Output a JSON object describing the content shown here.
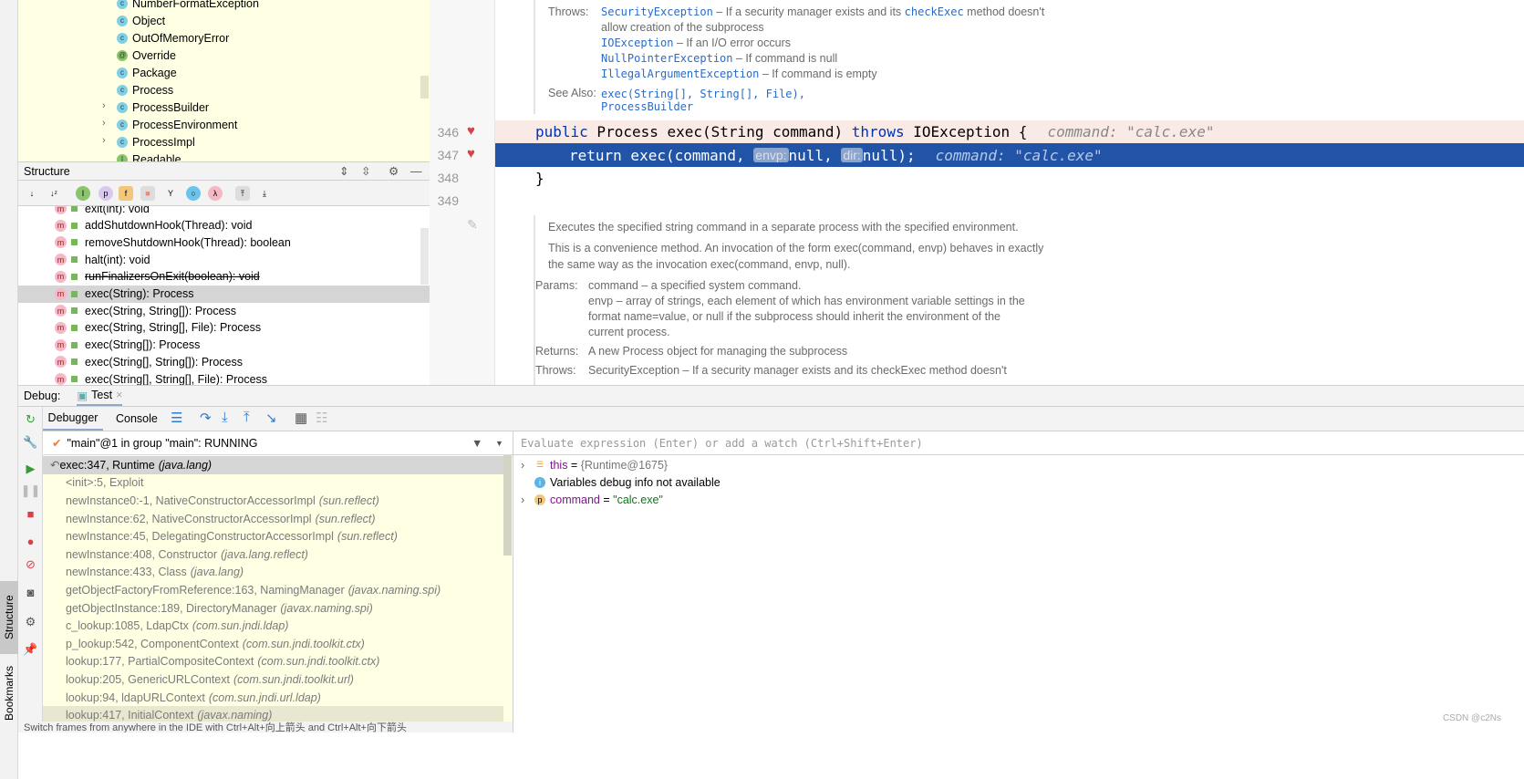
{
  "project_tree": {
    "items": [
      {
        "label": "NumberFormatException",
        "kind": "class",
        "expandable": false
      },
      {
        "label": "Object",
        "kind": "class",
        "expandable": false
      },
      {
        "label": "OutOfMemoryError",
        "kind": "class",
        "expandable": false
      },
      {
        "label": "Override",
        "kind": "annotation",
        "expandable": false
      },
      {
        "label": "Package",
        "kind": "class",
        "expandable": false
      },
      {
        "label": "Process",
        "kind": "abstract-class",
        "expandable": false
      },
      {
        "label": "ProcessBuilder",
        "kind": "class",
        "expandable": true
      },
      {
        "label": "ProcessEnvironment",
        "kind": "class",
        "expandable": true
      },
      {
        "label": "ProcessImpl",
        "kind": "class",
        "expandable": true
      },
      {
        "label": "Readable",
        "kind": "interface",
        "expandable": false
      }
    ]
  },
  "structure": {
    "title": "Structure",
    "items": [
      {
        "label": "exit(int): void",
        "deprecated": false,
        "selected": false
      },
      {
        "label": "addShutdownHook(Thread): void",
        "deprecated": false,
        "selected": false
      },
      {
        "label": "removeShutdownHook(Thread): boolean",
        "deprecated": false,
        "selected": false
      },
      {
        "label": "halt(int): void",
        "deprecated": false,
        "selected": false
      },
      {
        "label": "runFinalizersOnExit(boolean): void",
        "deprecated": true,
        "selected": false
      },
      {
        "label": "exec(String): Process",
        "deprecated": false,
        "selected": true
      },
      {
        "label": "exec(String, String[]): Process",
        "deprecated": false,
        "selected": false
      },
      {
        "label": "exec(String, String[], File): Process",
        "deprecated": false,
        "selected": false
      },
      {
        "label": "exec(String[]): Process",
        "deprecated": false,
        "selected": false
      },
      {
        "label": "exec(String[], String[]): Process",
        "deprecated": false,
        "selected": false
      },
      {
        "label": "exec(String[], String[], File): Process",
        "deprecated": false,
        "selected": false
      }
    ]
  },
  "editor": {
    "doc_top": {
      "throws_label": "Throws:",
      "throws": [
        {
          "name": "SecurityException",
          "text": " – If a security manager exists and its ",
          "code": "checkExec",
          "text2": " method doesn't"
        },
        {
          "name": "",
          "text": "allow creation of the subprocess"
        },
        {
          "name": "IOException",
          "text": " – If an I/O error occurs"
        },
        {
          "name": "NullPointerException",
          "text": " – If command is null"
        },
        {
          "name": "IllegalArgumentException",
          "text": " – If command is empty"
        }
      ],
      "see_also_label": "See Also:",
      "see_also": [
        "exec(String[], String[], File),",
        "ProcessBuilder"
      ]
    },
    "lines": [
      {
        "num": "346",
        "kw1": "public",
        "t1": " Process exec(String command) ",
        "kw2": "throws",
        "t2": " IOException {",
        "hint": "command: \"calc.exe\""
      },
      {
        "num": "347",
        "kw1": "return",
        "t1": " exec(command, ",
        "p1": "envp:",
        "t2": "null, ",
        "p2": "dir:",
        "t3": "null);",
        "hint": "command: \"calc.exe\""
      },
      {
        "num": "348",
        "t1": "}"
      },
      {
        "num": "349"
      }
    ],
    "doc_bottom": {
      "summary": "Executes the specified string command in a separate process with the specified environment.",
      "para1": "This is a convenience method. An invocation of the form exec(command, envp) behaves in exactly",
      "para2": "the same way as the invocation exec(command, envp, null).",
      "params_label": "Params:",
      "params": [
        "command – a specified system command.",
        "envp – array of strings, each element of which has environment variable settings in the",
        "format name=value, or null if the subprocess should inherit the environment of the",
        "current process."
      ],
      "returns_label": "Returns:",
      "returns": "A new Process object for managing the subprocess",
      "throws_label": "Throws:",
      "throws": "SecurityException – If a security manager exists and its checkExec method doesn't"
    }
  },
  "debug": {
    "label": "Debug:",
    "tab": "Test",
    "tabs": [
      "Debugger",
      "Console"
    ],
    "thread": "\"main\"@1 in group \"main\": RUNNING",
    "frames": [
      {
        "m": "exec:347, Runtime",
        "p": "(java.lang)",
        "current": true
      },
      {
        "m": "<init>:5, Exploit",
        "p": ""
      },
      {
        "m": "newInstance0:-1, NativeConstructorAccessorImpl",
        "p": "(sun.reflect)"
      },
      {
        "m": "newInstance:62, NativeConstructorAccessorImpl",
        "p": "(sun.reflect)"
      },
      {
        "m": "newInstance:45, DelegatingConstructorAccessorImpl",
        "p": "(sun.reflect)"
      },
      {
        "m": "newInstance:408, Constructor",
        "p": "(java.lang.reflect)"
      },
      {
        "m": "newInstance:433, Class",
        "p": "(java.lang)"
      },
      {
        "m": "getObjectFactoryFromReference:163, NamingManager",
        "p": "(javax.naming.spi)"
      },
      {
        "m": "getObjectInstance:189, DirectoryManager",
        "p": "(javax.naming.spi)"
      },
      {
        "m": "c_lookup:1085, LdapCtx",
        "p": "(com.sun.jndi.ldap)"
      },
      {
        "m": "p_lookup:542, ComponentContext",
        "p": "(com.sun.jndi.toolkit.ctx)"
      },
      {
        "m": "lookup:177, PartialCompositeContext",
        "p": "(com.sun.jndi.toolkit.ctx)"
      },
      {
        "m": "lookup:205, GenericURLContext",
        "p": "(com.sun.jndi.toolkit.url)"
      },
      {
        "m": "lookup:94, ldapURLContext",
        "p": "(com.sun.jndi.url.ldap)"
      },
      {
        "m": "lookup:417, InitialContext",
        "p": "(javax.naming)"
      }
    ],
    "status_hint": "Switch frames from anywhere in the IDE with Ctrl+Alt+向上箭头 and Ctrl+Alt+向下箭头",
    "eval_placeholder": "Evaluate expression (Enter) or add a watch (Ctrl+Shift+Enter)",
    "variables": [
      {
        "name": "this",
        "eq": " = ",
        "value": "{Runtime@1675}",
        "icon": "field-icon",
        "expandable": true
      },
      {
        "name": "",
        "eq": "",
        "value": "Variables debug info not available",
        "icon": "info-icon",
        "expandable": false
      },
      {
        "name": "command",
        "eq": " = ",
        "value": "\"calc.exe\"",
        "icon": "param-icon",
        "expandable": true
      }
    ]
  },
  "side_tabs": [
    "Structure",
    "Bookmarks"
  ],
  "watermark": "CSDN @c2Ns",
  "colors": {
    "exec_line": "#2154a6",
    "breakpoint_line": "#faeae6",
    "tree_bg": "#ffffe4",
    "link": "#2b6bc4",
    "keyword": "#0033b3"
  }
}
